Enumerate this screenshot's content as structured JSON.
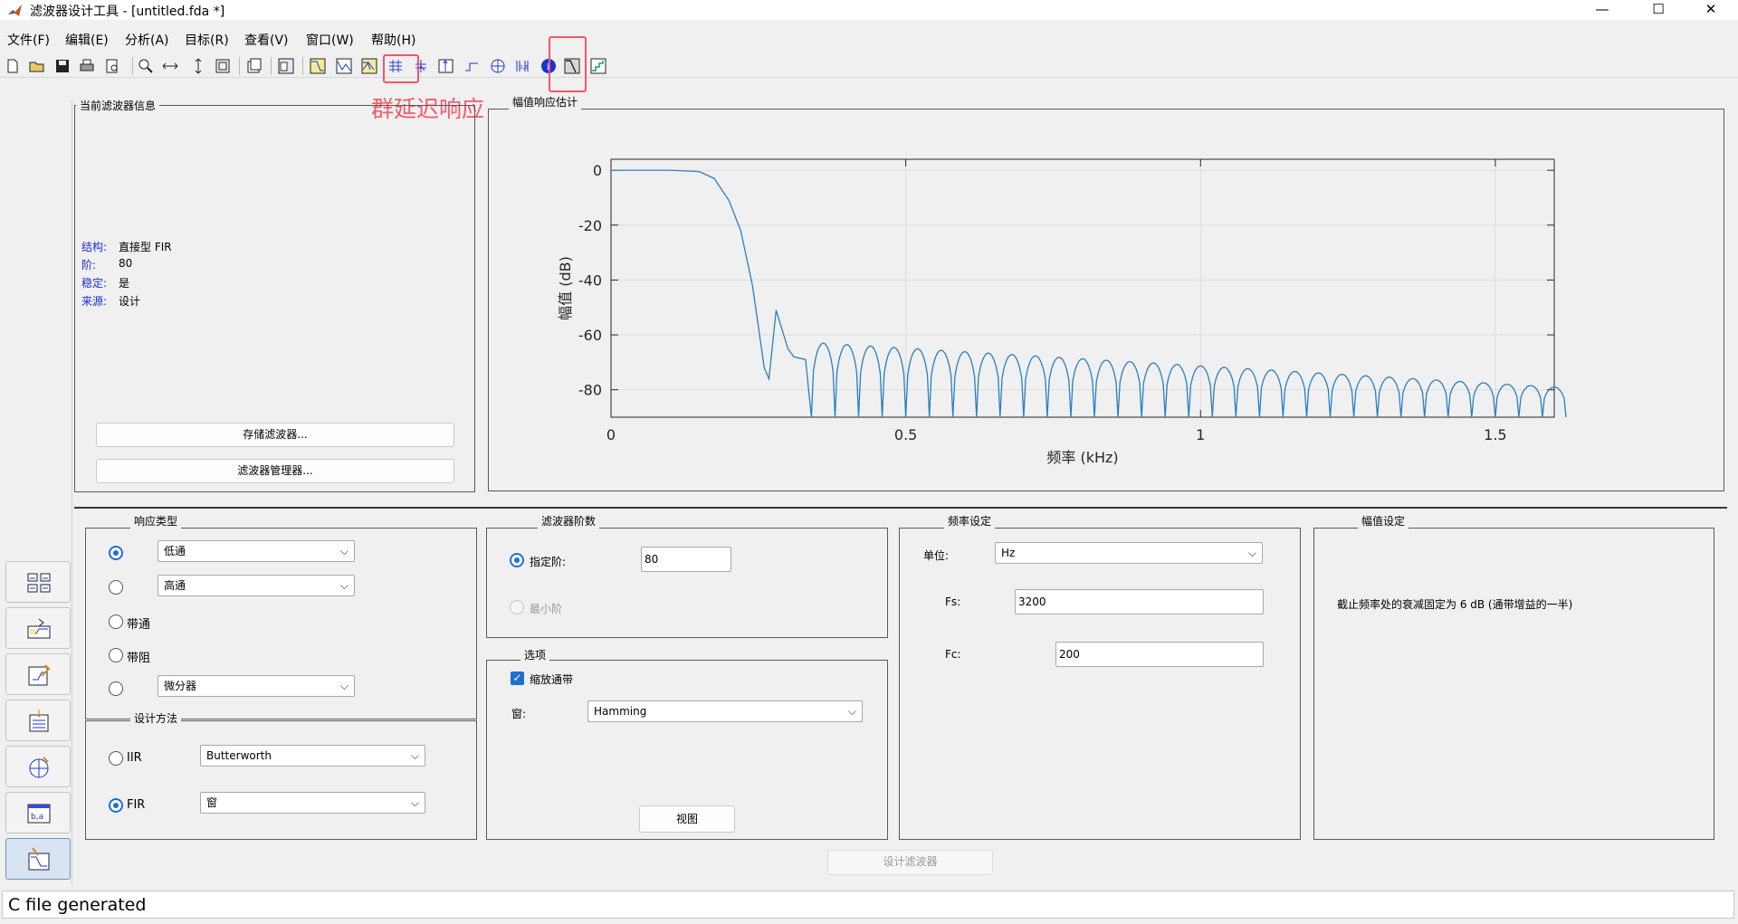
{
  "window": {
    "title": "滤波器设计工具 -  [untitled.fda *]",
    "minimize": "—",
    "maximize": "☐",
    "close": "✕"
  },
  "menu": [
    "文件(F)",
    "编辑(E)",
    "分析(A)",
    "目标(R)",
    "查看(V)",
    "窗口(W)",
    "帮助(H)"
  ],
  "toolbar": {
    "icons": [
      "new-file-icon",
      "open-file-icon",
      "save-icon",
      "print-icon",
      "print-preview-icon",
      "zoom-in-icon",
      "zoom-x-icon",
      "zoom-y-icon",
      "full-view-icon",
      "new-figure-icon",
      "full-view-analysis-icon",
      "magnitude-response-icon",
      "phase-response-icon",
      "magnitude-phase-icon",
      "group-delay-icon",
      "phase-delay-icon",
      "impulse-response-icon",
      "step-response-icon",
      "pole-zero-icon",
      "filter-coefficients-icon",
      "filter-info-icon",
      "magnitude-estimate-icon",
      "round-off-noise-icon"
    ],
    "annotation": "群延迟响应"
  },
  "info_panel": {
    "title": "当前滤波器信息",
    "rows": [
      {
        "label": "结构:",
        "value": "直接型 FIR"
      },
      {
        "label": "阶:",
        "value": "80"
      },
      {
        "label": "稳定:",
        "value": "是"
      },
      {
        "label": "来源:",
        "value": "设计"
      }
    ],
    "store_button": "存储滤波器...",
    "manager_button": "滤波器管理器..."
  },
  "plot_panel": {
    "title": "幅值响应估计"
  },
  "chart_data": {
    "type": "line",
    "title": "",
    "xlabel": "频率 (kHz)",
    "ylabel": "幅值 (dB)",
    "xlim": [
      0,
      1.6
    ],
    "ylim": [
      -90,
      4
    ],
    "xticks": [
      0,
      0.5,
      1,
      1.5
    ],
    "xtick_labels": [
      "0",
      "0.5",
      "1",
      "1.5"
    ],
    "yticks": [
      0,
      -20,
      -40,
      -60,
      -80
    ],
    "ytick_labels": [
      "0",
      "-20",
      "-40",
      "-60",
      "-80"
    ],
    "grid": true,
    "line_color": "#2a7fc0",
    "series": [
      {
        "x": [
          0,
          0.1,
          0.15,
          0.175,
          0.2,
          0.22,
          0.24,
          0.26,
          0.268,
          0.28,
          0.3,
          0.31,
          0.33,
          0.34
        ],
        "y": [
          0,
          0,
          -0.5,
          -3,
          -11,
          -22,
          -42,
          -72,
          -76,
          -51,
          -65,
          -68,
          -69,
          -90
        ],
        "sidelobes": {
          "x_start": 0.34,
          "x_end": 1.6,
          "period": 0.04,
          "peak_start": -63,
          "peak_end": -79,
          "null": -90
        }
      }
    ]
  },
  "response_type": {
    "title": "响应类型",
    "options": [
      {
        "label": "低通",
        "type": "select",
        "checked": true
      },
      {
        "label": "高通",
        "type": "select",
        "checked": false
      },
      {
        "label": "带通",
        "type": "text",
        "checked": false
      },
      {
        "label": "带阻",
        "type": "text",
        "checked": false
      },
      {
        "label": "微分器",
        "type": "select",
        "checked": false
      }
    ]
  },
  "design_method": {
    "title": "设计方法",
    "iir_label": "IIR",
    "iir_value": "Butterworth",
    "fir_label": "FIR",
    "fir_value": "窗"
  },
  "filter_order": {
    "title": "滤波器阶数",
    "specify_label": "指定阶:",
    "specify_value": "80",
    "minimum_label": "最小阶"
  },
  "options": {
    "title": "选项",
    "scale_label": "缩放通带",
    "window_label": "窗:",
    "window_value": "Hamming",
    "view_button": "视图"
  },
  "frequency": {
    "title": "频率设定",
    "units_label": "单位:",
    "units_value": "Hz",
    "fs_label": "Fs:",
    "fs_value": "3200",
    "fc_label": "Fc:",
    "fc_value": "200"
  },
  "magnitude": {
    "title": "幅值设定",
    "note": "截止频率处的衰减固定为 6 dB (通带增益的一半)"
  },
  "design_button": "设计滤波器",
  "side_panel": {
    "icons": [
      "transform-filter-icon",
      "create-multirate-icon",
      "realize-model-icon",
      "import-filter-icon",
      "pole-zero-editor-icon",
      "quantize-filter-icon",
      "design-filter-icon"
    ]
  },
  "status": "C file generated"
}
